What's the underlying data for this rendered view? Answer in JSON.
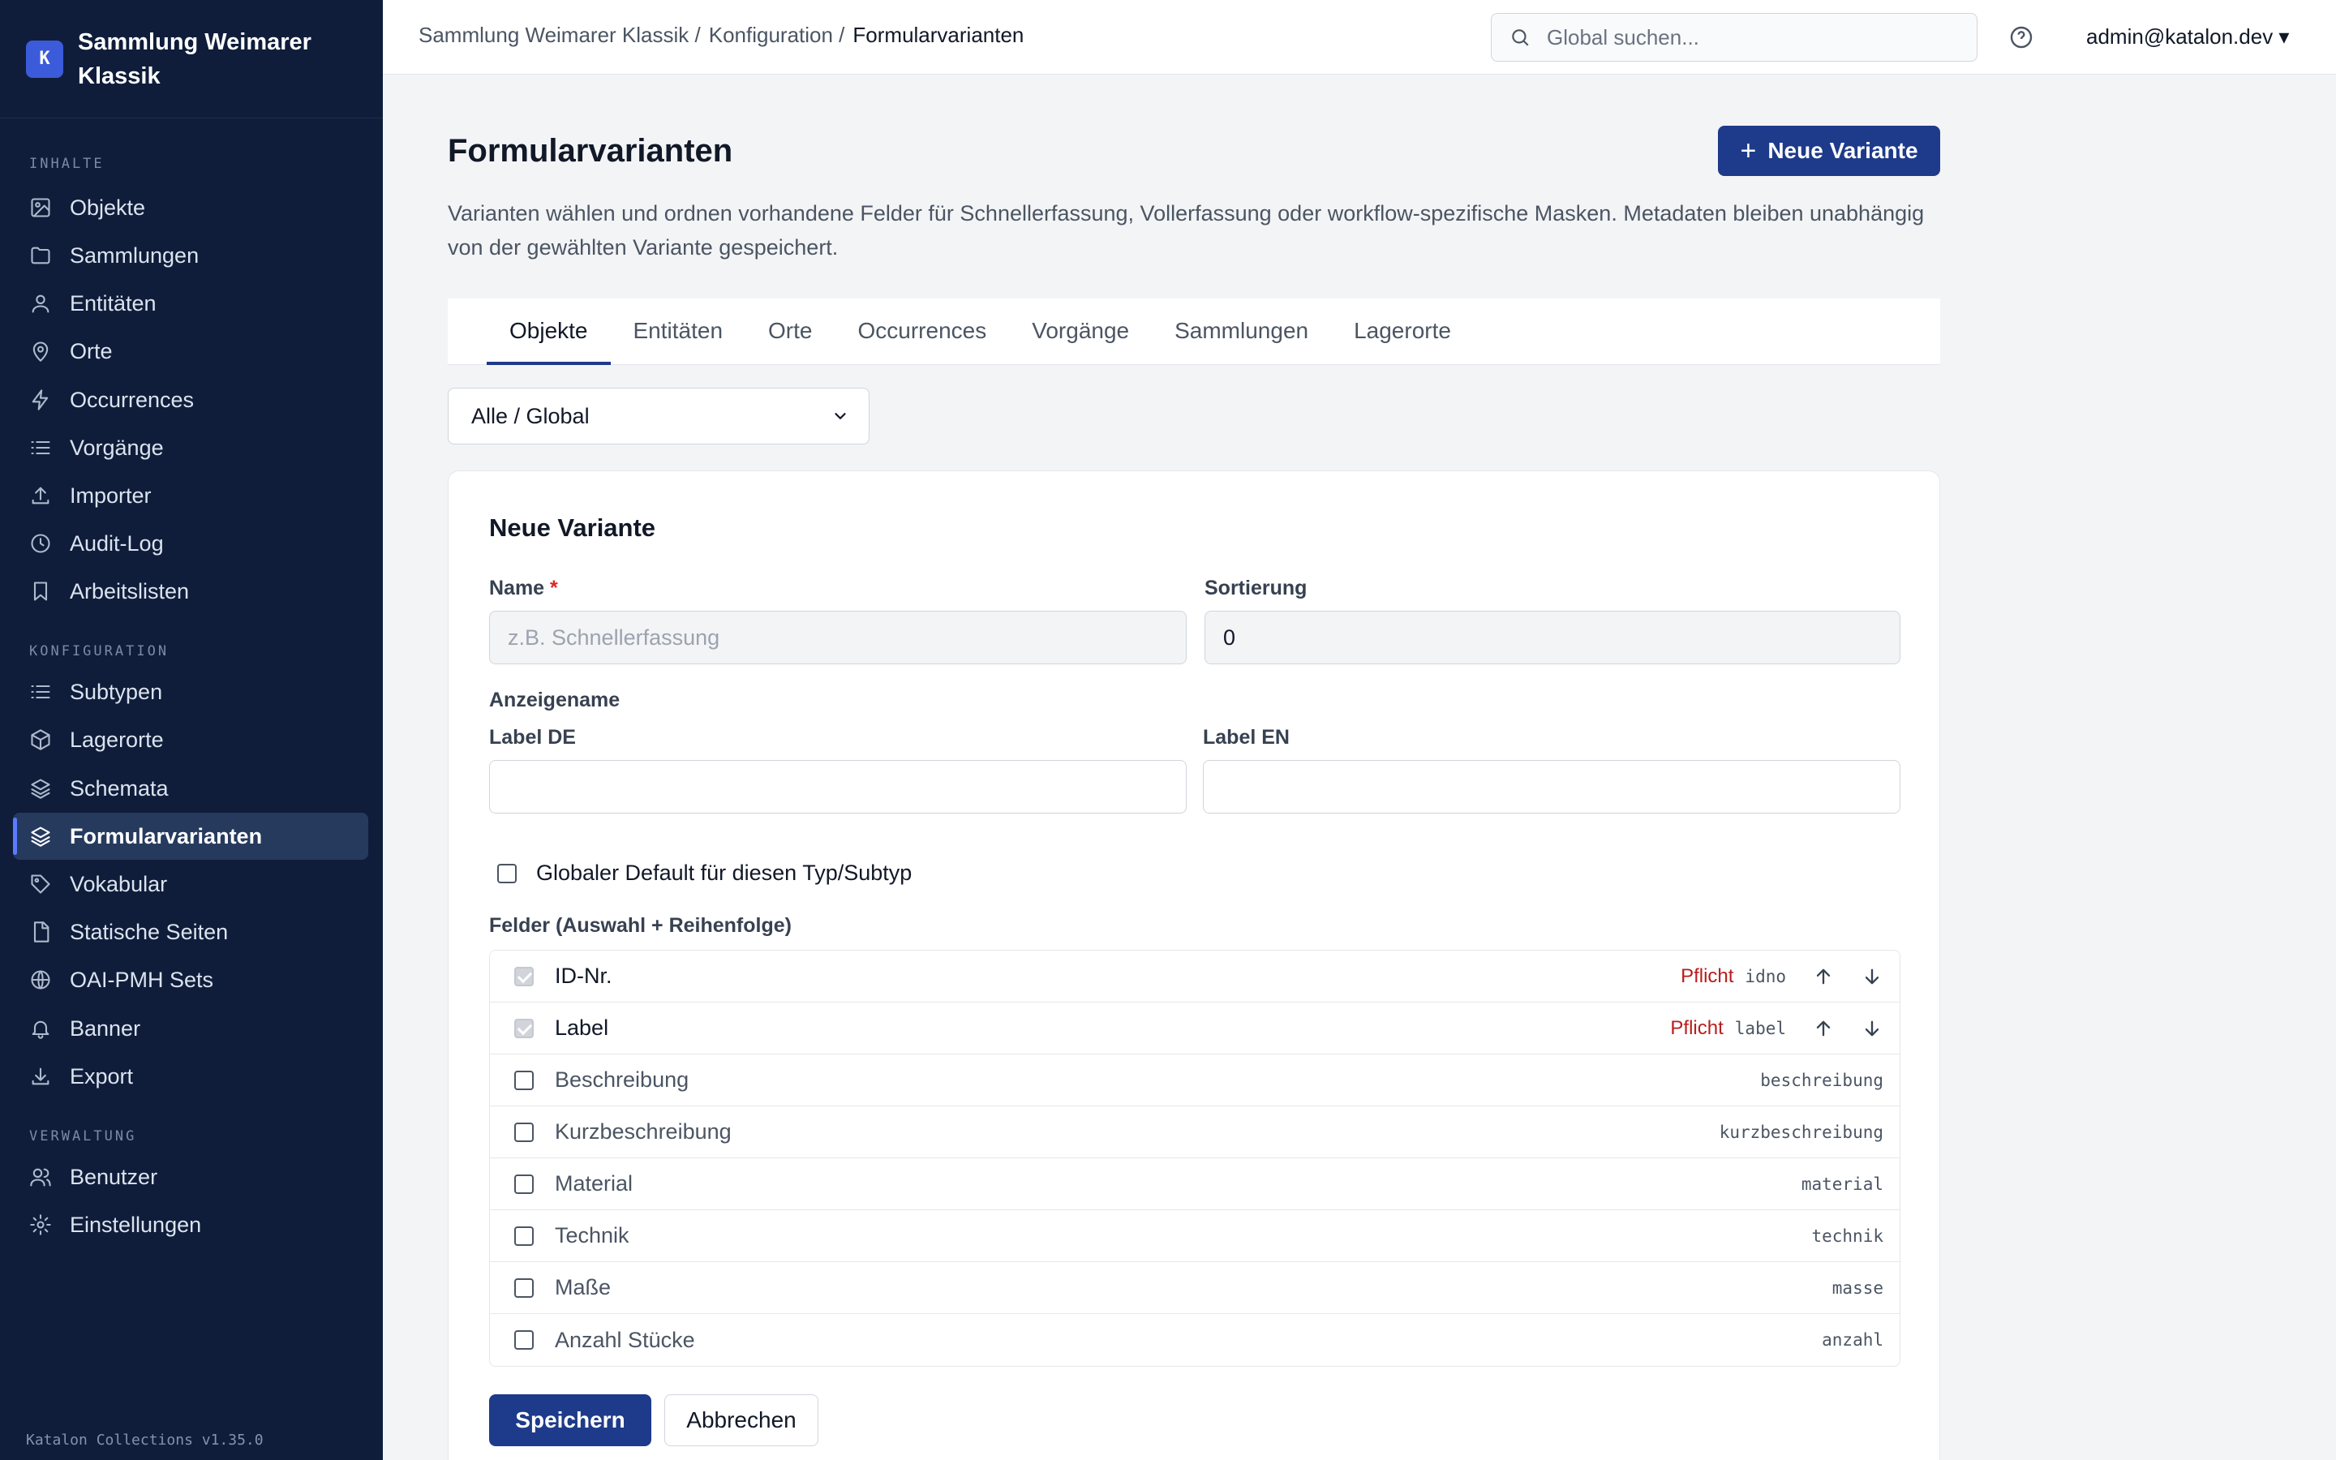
{
  "brand": {
    "logo_letter": "K",
    "name": "Sammlung Weimarer Klassik"
  },
  "sidebar": {
    "sections": [
      {
        "title": "INHALTE"
      },
      {
        "title": "KONFIGURATION"
      },
      {
        "title": "VERWALTUNG"
      }
    ],
    "items": [
      {
        "label": "Objekte",
        "icon": "image-icon"
      },
      {
        "label": "Sammlungen",
        "icon": "folder-icon"
      },
      {
        "label": "Entitäten",
        "icon": "user-icon"
      },
      {
        "label": "Orte",
        "icon": "map-pin-icon"
      },
      {
        "label": "Occurrences",
        "icon": "bolt-icon"
      },
      {
        "label": "Vorgänge",
        "icon": "list-icon"
      },
      {
        "label": "Importer",
        "icon": "upload-icon"
      },
      {
        "label": "Audit-Log",
        "icon": "clock-icon"
      },
      {
        "label": "Arbeitslisten",
        "icon": "bookmark-icon"
      },
      {
        "label": "Subtypen",
        "icon": "list-icon"
      },
      {
        "label": "Lagerorte",
        "icon": "box-icon"
      },
      {
        "label": "Schemata",
        "icon": "layers-icon"
      },
      {
        "label": "Formularvarianten",
        "icon": "layers-icon",
        "active": true
      },
      {
        "label": "Vokabular",
        "icon": "tag-icon"
      },
      {
        "label": "Statische Seiten",
        "icon": "file-icon"
      },
      {
        "label": "OAI-PMH Sets",
        "icon": "globe-icon"
      },
      {
        "label": "Banner",
        "icon": "bell-icon"
      },
      {
        "label": "Export",
        "icon": "download-icon"
      },
      {
        "label": "Benutzer",
        "icon": "users-icon"
      },
      {
        "label": "Einstellungen",
        "icon": "gear-icon"
      }
    ],
    "version": "Katalon Collections v1.35.0"
  },
  "topbar": {
    "breadcrumb": [
      "Sammlung Weimarer Klassik /",
      "Konfiguration /",
      "Formularvarianten"
    ],
    "search_placeholder": "Global suchen...",
    "user": "admin@katalon.dev ▾"
  },
  "main": {
    "title": "Formularvarianten",
    "new_button": "Neue Variante",
    "description": "Varianten wählen und ordnen vorhandene Felder für Schnellerfassung, Vollerfassung oder workflow-spezifische Masken. Metadaten bleiben unabhängig von der gewählten Variante gespeichert.",
    "tabs": [
      "Objekte",
      "Entitäten",
      "Orte",
      "Occurrences",
      "Vorgänge",
      "Sammlungen",
      "Lagerorte"
    ],
    "active_tab": "Objekte",
    "scope_select": "Alle / Global"
  },
  "form": {
    "title": "Neue Variante",
    "name_label": "Name",
    "required_mark": "*",
    "name_placeholder": "z.B. Schnellerfassung",
    "sort_label": "Sortierung",
    "sort_value": "0",
    "display_name_label": "Anzeigename",
    "label_de": "Label DE",
    "label_en": "Label EN",
    "label_de_value": "",
    "label_en_value": "",
    "global_default_label": "Globaler Default für diesen Typ/Subtyp",
    "global_default_checked": false,
    "fields_label": "Felder (Auswahl + Reihenfolge)",
    "fields": [
      {
        "name": "ID-Nr.",
        "key": "idno",
        "required": "Pflicht",
        "checked": true
      },
      {
        "name": "Label",
        "key": "label",
        "required": "Pflicht",
        "checked": true
      },
      {
        "name": "Beschreibung",
        "key": "beschreibung",
        "checked": false
      },
      {
        "name": "Kurzbeschreibung",
        "key": "kurzbeschreibung",
        "checked": false
      },
      {
        "name": "Material",
        "key": "material",
        "checked": false
      },
      {
        "name": "Technik",
        "key": "technik",
        "checked": false
      },
      {
        "name": "Maße",
        "key": "masse",
        "checked": false
      },
      {
        "name": "Anzahl Stücke",
        "key": "anzahl",
        "checked": false
      }
    ],
    "save_button": "Speichern",
    "cancel_button": "Abbrechen"
  },
  "colors": {
    "sidebar_bg": "#0f1d3a",
    "primary": "#1e3a8a",
    "required": "#b91c1c"
  }
}
